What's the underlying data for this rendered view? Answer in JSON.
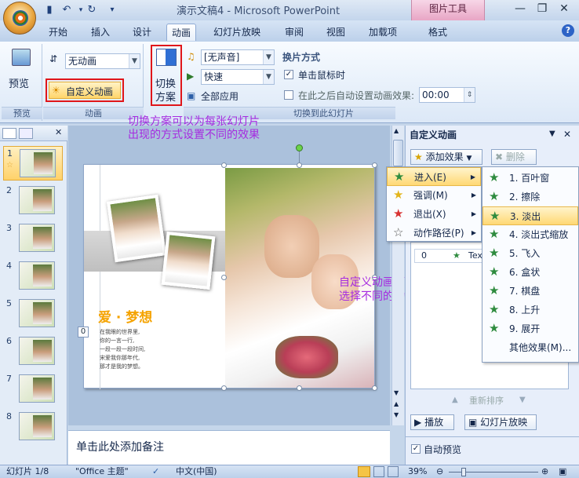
{
  "window": {
    "title": "演示文稿4 - Microsoft PowerPoint",
    "context_tab": "图片工具",
    "qat": {
      "save_icon": "floppy-icon",
      "undo_icon": "undo-icon",
      "redo_icon": "redo-icon"
    }
  },
  "tabs": [
    {
      "label": "开始"
    },
    {
      "label": "插入"
    },
    {
      "label": "设计"
    },
    {
      "label": "动画",
      "active": true
    },
    {
      "label": "幻灯片放映"
    },
    {
      "label": "审阅"
    },
    {
      "label": "视图"
    },
    {
      "label": "加载项"
    },
    {
      "label": "格式"
    }
  ],
  "ribbon": {
    "preview_group": {
      "button": "预览",
      "label": "预览"
    },
    "animation_group": {
      "anim_combo": "无动画",
      "custom_button": "自定义动画",
      "label": "动画"
    },
    "transition_group": {
      "scheme_button_line1": "切换",
      "scheme_button_line2": "方案",
      "sound_combo": "[无声音]",
      "speed_combo": "快速",
      "apply_all": "全部应用",
      "advance_title": "换片方式",
      "on_click": "单击鼠标时",
      "auto_after": "在此之后自动设置动画效果:",
      "auto_time": "00:00",
      "label": "切换到此幻灯片"
    }
  },
  "callouts": {
    "transition_line1": "切换方案可以为每张幻灯片",
    "transition_line2": "出现的方式设置不同的效果",
    "custom_line1": "自定义动画可以为每个图片或文字",
    "custom_line2": "选择不同的动画效果"
  },
  "slides": [
    {
      "num": "1"
    },
    {
      "num": "2"
    },
    {
      "num": "3"
    },
    {
      "num": "4"
    },
    {
      "num": "5"
    },
    {
      "num": "6"
    },
    {
      "num": "7"
    },
    {
      "num": "8"
    }
  ],
  "slide": {
    "title": "爱 · 梦想",
    "badge": "0",
    "lines": [
      "在我眼的世界里,",
      "你的一言一行,",
      "一段一段一段时间,",
      "宋爱我你那年代,",
      "那才是我的梦想。"
    ]
  },
  "notes_placeholder": "单击此处添加备注",
  "taskpane": {
    "title": "自定义动画",
    "add_effect": "添加效果",
    "delete": "删除",
    "list_item_num": "0",
    "list_item_text": "Tex",
    "reorder": "重新排序",
    "play": "播放",
    "slideshow": "幻灯片放映",
    "autopreview": "自动预览"
  },
  "menu_main": [
    {
      "label": "进入(E)",
      "icon": "star-green-icon",
      "color": "#2e8b3e",
      "highlighted": true
    },
    {
      "label": "强调(M)",
      "icon": "star-yellow-icon",
      "color": "#e3b51c"
    },
    {
      "label": "退出(X)",
      "icon": "star-red-icon",
      "color": "#d83232"
    },
    {
      "label": "动作路径(P)",
      "icon": "star-outline-icon",
      "color": "#555555"
    }
  ],
  "menu_entry": [
    {
      "label": "1. 百叶窗"
    },
    {
      "label": "2. 擦除"
    },
    {
      "label": "3. 淡出",
      "highlighted": true
    },
    {
      "label": "4. 淡出式缩放"
    },
    {
      "label": "5. 飞入"
    },
    {
      "label": "6. 盒状"
    },
    {
      "label": "7. 棋盘"
    },
    {
      "label": "8. 上升"
    },
    {
      "label": "9. 展开"
    },
    {
      "label": "其他效果(M)..."
    }
  ],
  "status": {
    "slide_of": "幻灯片 1/8",
    "theme": "\"Office 主题\"",
    "language": "中文(中国)",
    "zoom": "39%"
  },
  "colors": {
    "accent_red": "#e0161a",
    "callout": "#a62be0",
    "title_orange": "#f5a300"
  }
}
